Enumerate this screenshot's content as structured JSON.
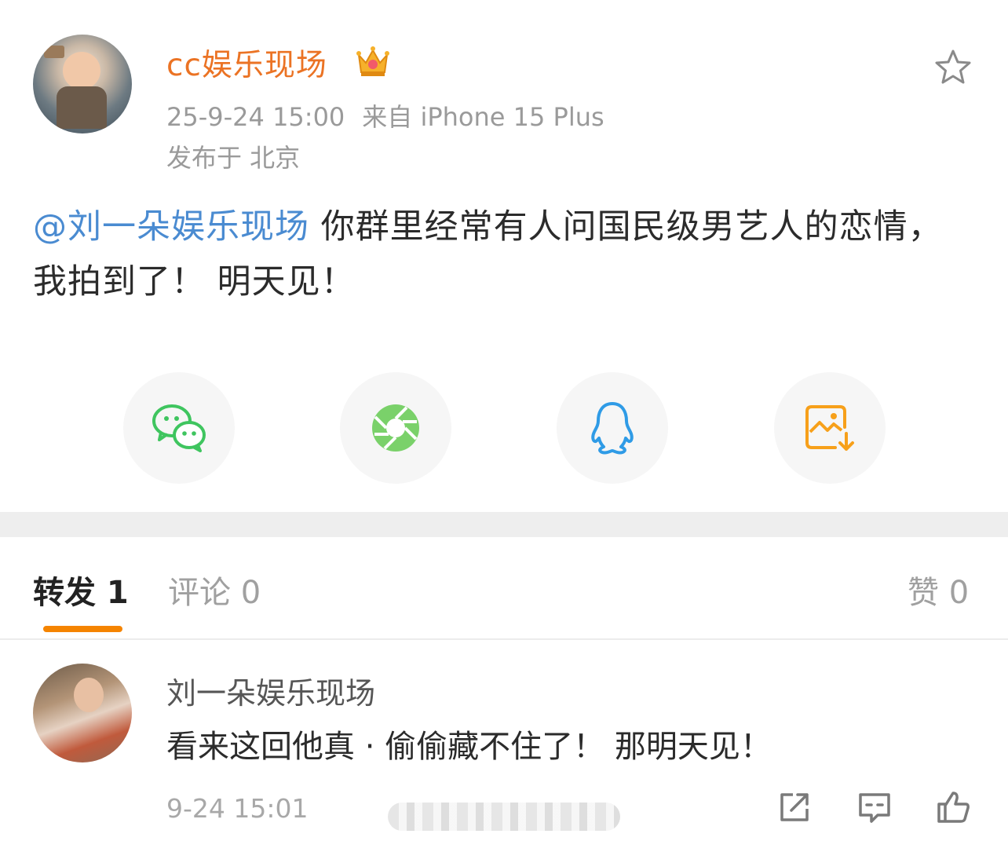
{
  "post": {
    "author": "cc娱乐现场",
    "timestamp": "25-9-24 15:00",
    "source": "来自 iPhone 15 Plus",
    "location": "发布于 北京",
    "mention": "@刘一朵娱乐现场",
    "text": " 你群里经常有人问国民级男艺人的恋情，我拍到了！ 明天见！"
  },
  "share": {
    "items": [
      "wechat-icon",
      "moments-icon",
      "qq-icon",
      "save-image-icon"
    ]
  },
  "tabs": {
    "repost": "转发 1",
    "comment": "评论 0",
    "like": "赞 0"
  },
  "comment": {
    "author": "刘一朵娱乐现场",
    "text": "看来这回他真 · 偷偷藏不住了！ 那明天见！",
    "time": "9-24 15:01"
  },
  "colors": {
    "author": "#eb7324",
    "mention": "#4a8bd1",
    "tab_indicator": "#f58400",
    "wechat": "#3fc55f",
    "moments": "#7ad16a",
    "qq": "#2f9be6",
    "save": "#f7a01a"
  }
}
